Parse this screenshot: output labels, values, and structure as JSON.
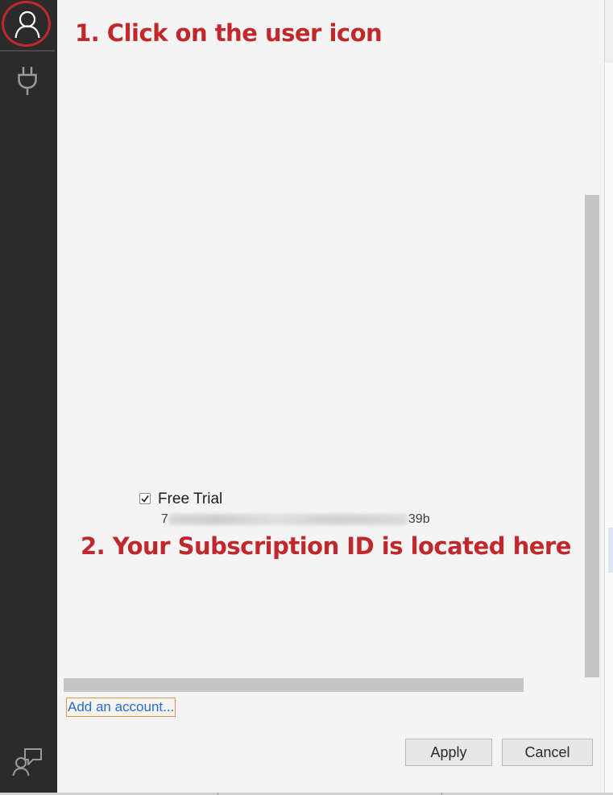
{
  "annotations": {
    "step1": "1. Click on the user icon",
    "step2": "2. Your Subscription ID is located here"
  },
  "sidebar": {
    "items": [
      {
        "icon": "user-icon"
      },
      {
        "icon": "plug-icon"
      },
      {
        "icon": "feedback-icon"
      }
    ]
  },
  "subscription": {
    "name": "Free Trial",
    "checked": true,
    "id_prefix": "7",
    "id_suffix": "39b"
  },
  "account": {
    "add_label": "Add an account..."
  },
  "buttons": {
    "apply": "Apply",
    "cancel": "Cancel"
  },
  "colors": {
    "sidebar_bg": "#2b2b2b",
    "panel_bg": "#f4f4f4",
    "annotation": "#c0282b",
    "link": "#2d6bc2",
    "focus_border": "#d39c38"
  }
}
